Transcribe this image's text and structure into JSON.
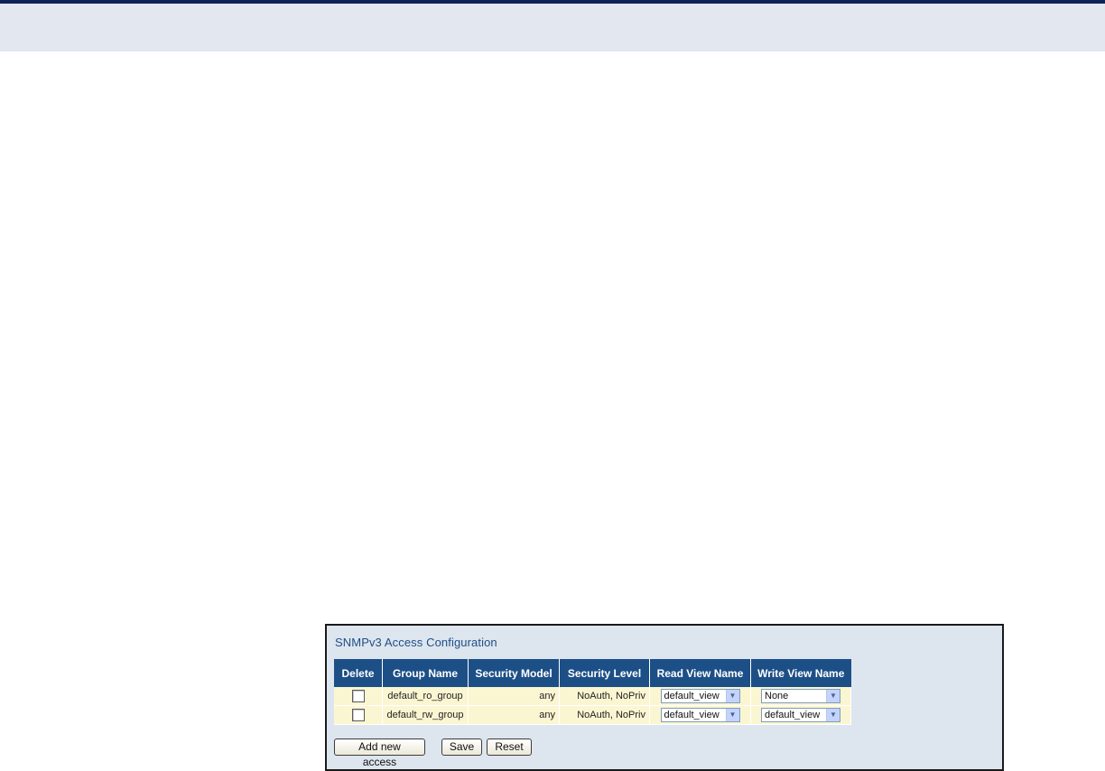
{
  "panel": {
    "title": "SNMPv3 Access Configuration"
  },
  "table": {
    "headers": [
      "Delete",
      "Group Name",
      "Security Model",
      "Security Level",
      "Read View Name",
      "Write View Name"
    ],
    "rows": [
      {
        "group_name": "default_ro_group",
        "security_model": "any",
        "security_level": "NoAuth, NoPriv",
        "read_view": "default_view",
        "write_view": "None"
      },
      {
        "group_name": "default_rw_group",
        "security_model": "any",
        "security_level": "NoAuth, NoPriv",
        "read_view": "default_view",
        "write_view": "default_view"
      }
    ]
  },
  "buttons": {
    "add_new_access": "Add new access",
    "save": "Save",
    "reset": "Reset"
  },
  "icons": {
    "dropdown": "chevron-down-icon"
  },
  "colors": {
    "header_bg": "#1d4f87",
    "row_bg": "#fbf6d2",
    "panel_bg": "#dde5ee",
    "title_color": "#1f4f87"
  }
}
